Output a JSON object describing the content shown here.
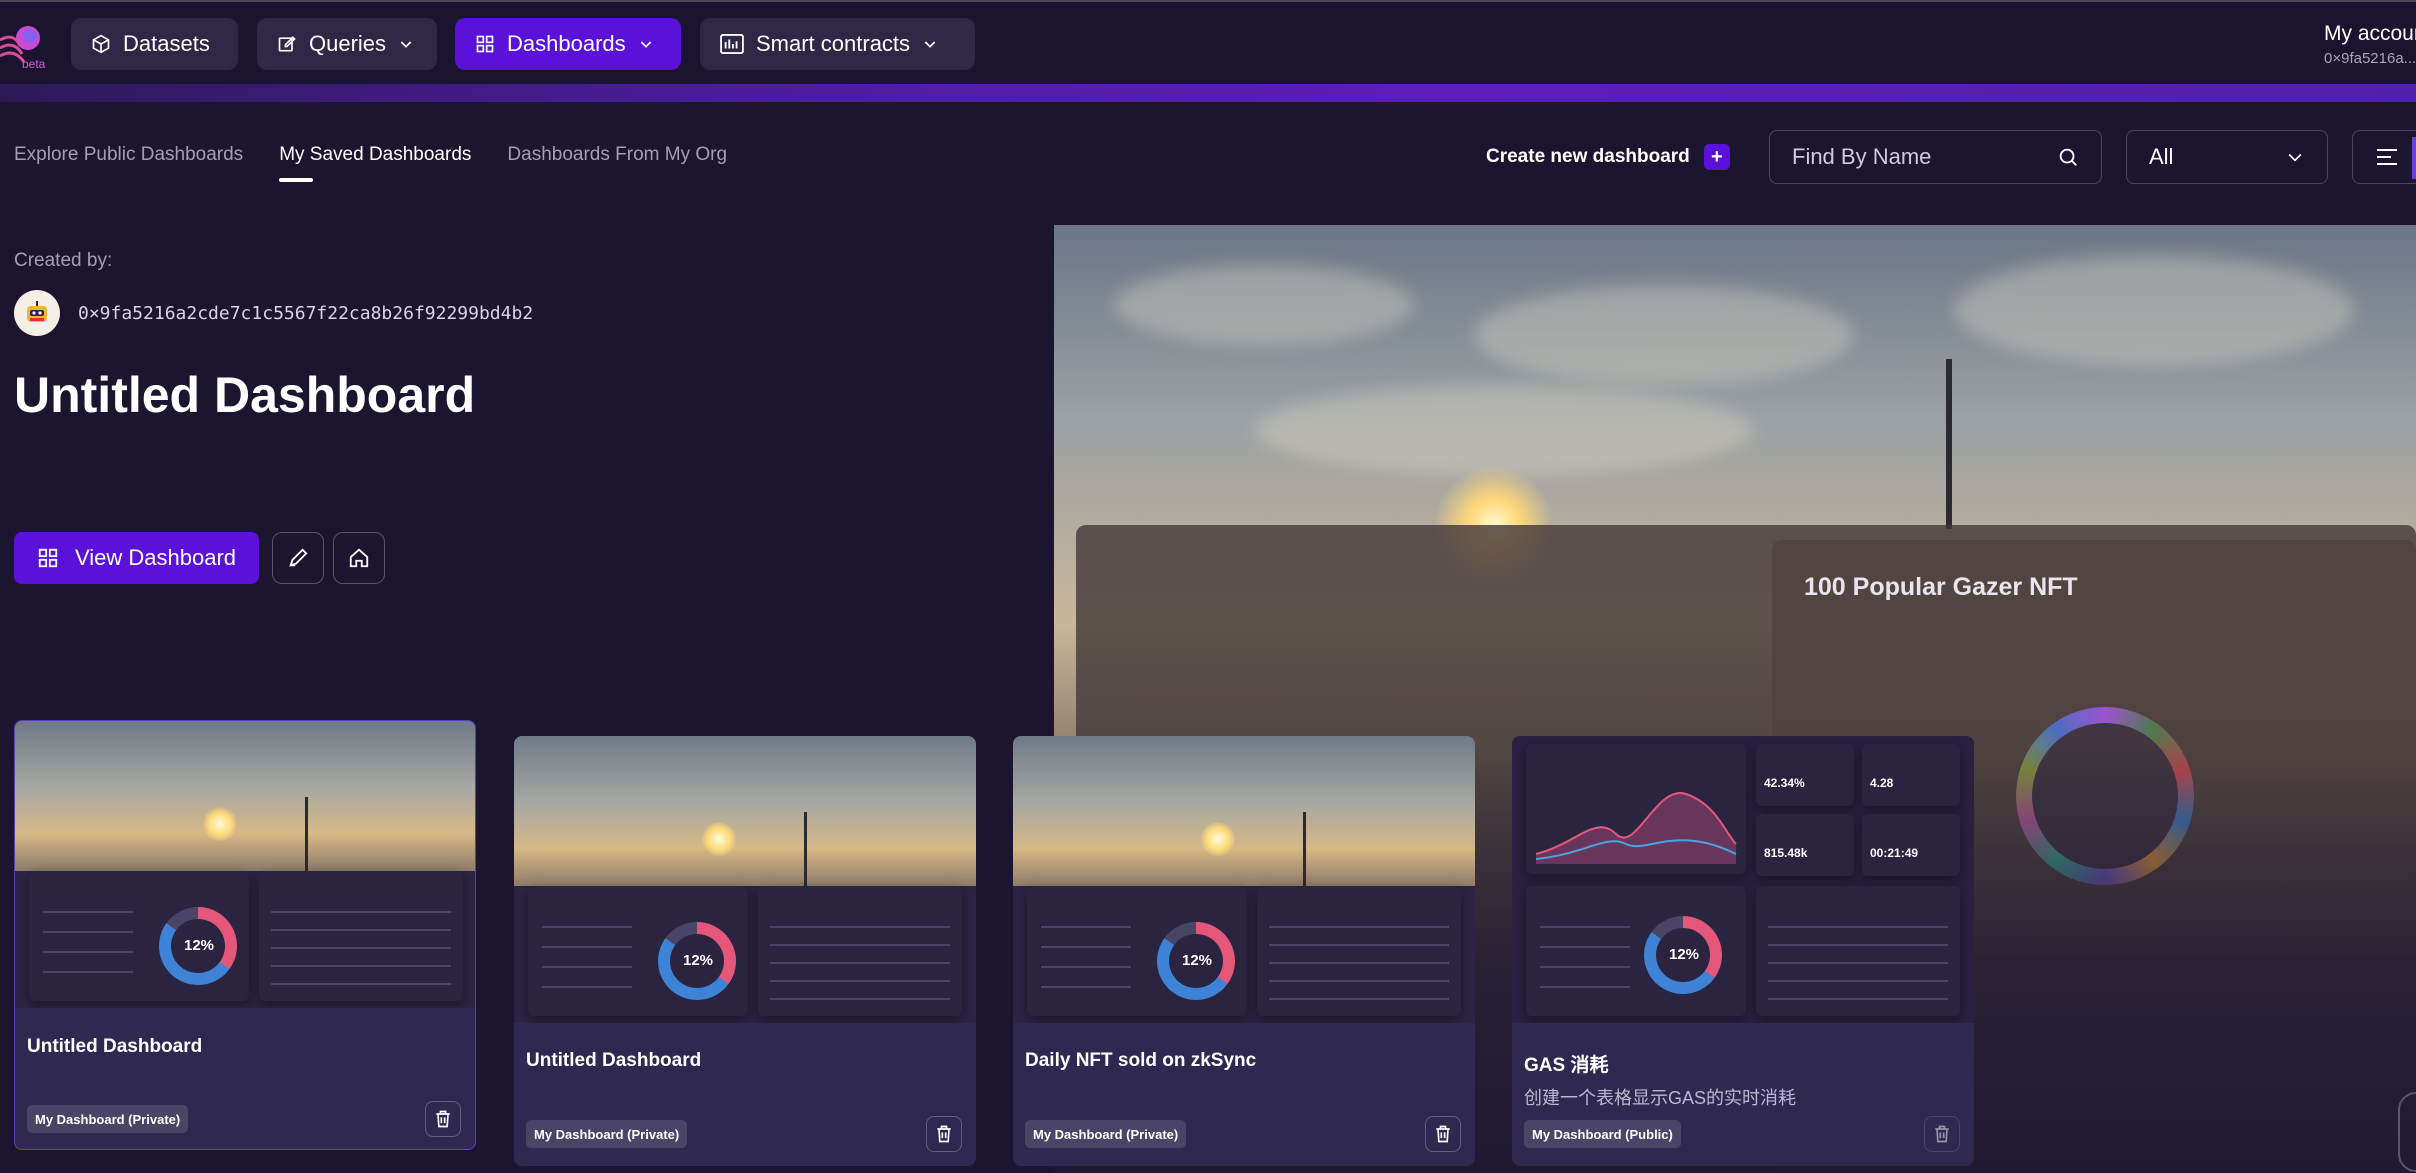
{
  "nav": {
    "logo_badge": "beta",
    "items": [
      {
        "label": "Datasets",
        "icon": "cube-icon"
      },
      {
        "label": "Queries",
        "icon": "edit-square-icon"
      },
      {
        "label": "Dashboards",
        "icon": "grid-icon"
      },
      {
        "label": "Smart contracts",
        "icon": "bar-chart-icon"
      }
    ],
    "account_label": "My account",
    "account_address": "0×9fa5216a..."
  },
  "tabs": [
    {
      "label": "Explore Public Dashboards",
      "active": false
    },
    {
      "label": "My Saved Dashboards",
      "active": true
    },
    {
      "label": "Dashboards From My Org",
      "active": false
    }
  ],
  "toolbar": {
    "create_label": "Create new dashboard",
    "create_plus": "+",
    "search_placeholder": "Find By Name",
    "filter_value": "All"
  },
  "featured": {
    "created_by_label": "Created by:",
    "creator_address": "0×9fa5216a2cde7c1c5567f22ca8b26f92299bd4b2",
    "title": "Untitled Dashboard",
    "view_button": "View Dashboard",
    "preview_panel_title": "100 Popular Gazer NFT"
  },
  "cards": [
    {
      "title": "Untitled Dashboard",
      "description": "",
      "badge": "My Dashboard (Private)",
      "thumb": "photo",
      "donut_value": "12%"
    },
    {
      "title": "Untitled Dashboard",
      "description": "",
      "badge": "My Dashboard (Private)",
      "thumb": "photo",
      "donut_value": "12%"
    },
    {
      "title": "Daily NFT sold on zkSync",
      "description": "",
      "badge": "My Dashboard (Private)",
      "thumb": "photo",
      "donut_value": "12%"
    },
    {
      "title": "GAS 消耗",
      "description": "创建一个表格显示GAS的实时消耗",
      "badge": "My Dashboard (Public)",
      "thumb": "stats",
      "donut_value": "12%",
      "stats": [
        "42.34%",
        "4.28",
        "815.48k",
        "00:21:49"
      ]
    }
  ],
  "colors": {
    "accent": "#5a12d8",
    "background": "#1b1530",
    "card": "#2f2850"
  }
}
